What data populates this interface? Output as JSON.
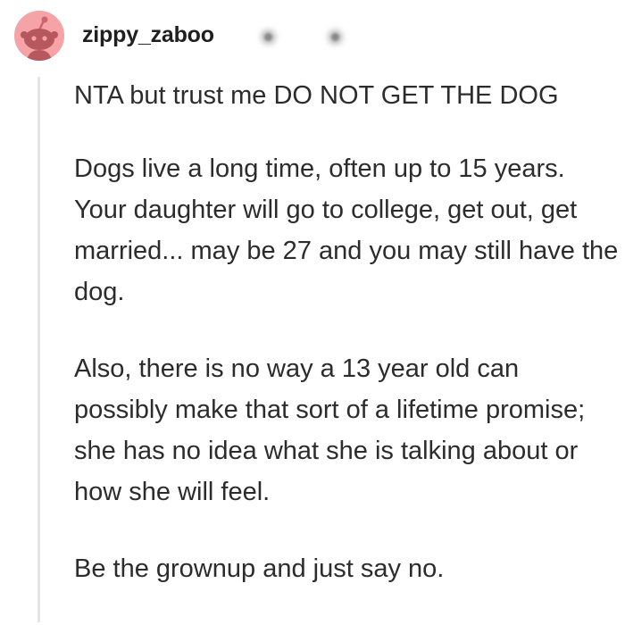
{
  "comment": {
    "username": "zippy_zaboo",
    "avatar_icon": "reddit-snoo-icon",
    "avatar_color": "#f5a3a6",
    "paragraphs": [
      "NTA but trust me DO NOT GET THE DOG",
      "Dogs live a long time, often up to 15 years. Your daughter will go to college, get out, get married... may be 27 and you may still have the dog.",
      "Also, there is no way a 13 year old can possibly make that sort of a lifetime promise; she has no idea what she is talking about or how she will feel.",
      "Be the grownup and just say no."
    ]
  }
}
